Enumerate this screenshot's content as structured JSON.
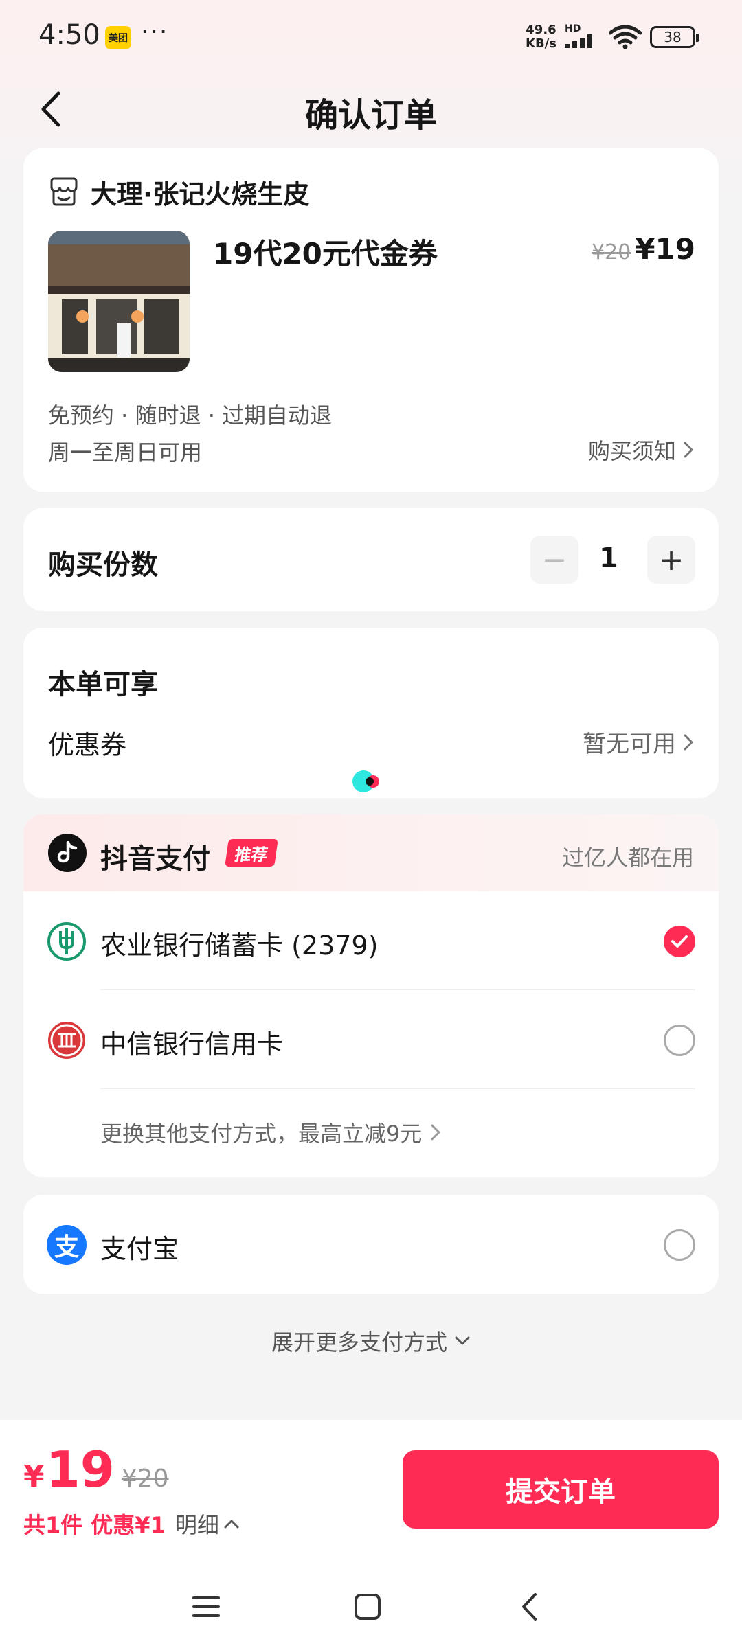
{
  "status_bar": {
    "time": "4:50",
    "app_badge": "美团",
    "more": "···",
    "net_speed_value": "49.6",
    "net_speed_unit": "KB/s",
    "signal_label": "HD",
    "battery": "38"
  },
  "header": {
    "title": "确认订单"
  },
  "product_card": {
    "store_name": "大理·张记火烧生皮",
    "product_title": "19代20元代金券",
    "price_original": "¥20",
    "price_now": "¥19",
    "tags": "免预约 · 随时退 · 过期自动退",
    "available_days": "周一至周日可用",
    "notice_link": "购买须知"
  },
  "quantity_card": {
    "label": "购买份数",
    "minus": "−",
    "plus": "+",
    "value": "1"
  },
  "benefit_card": {
    "title": "本单可享",
    "coupon_label": "优惠券",
    "coupon_value": "暂无可用"
  },
  "payment": {
    "douyin_pay_label": "抖音支付",
    "recommend_badge": "推荐",
    "douyin_pay_subtitle": "过亿人都在用",
    "methods": [
      {
        "name": "农业银行储蓄卡 (2379)",
        "selected": true
      },
      {
        "name": "中信银行信用卡",
        "selected": false
      }
    ],
    "other_methods": "更换其他支付方式，最高立减9元",
    "alipay": {
      "icon_char": "支",
      "name": "支付宝",
      "selected": false
    },
    "expand_more": "展开更多支付方式"
  },
  "bottom_bar": {
    "currency_symbol": "¥",
    "total": "19",
    "total_original": "¥20",
    "count": "共1件",
    "discount": "优惠¥1",
    "detail": "明细",
    "submit": "提交订单"
  },
  "colors": {
    "accent": "#fe2c55",
    "alipay": "#1677ff",
    "abc_green": "#1a9a6c",
    "citic_red": "#d9373a"
  }
}
